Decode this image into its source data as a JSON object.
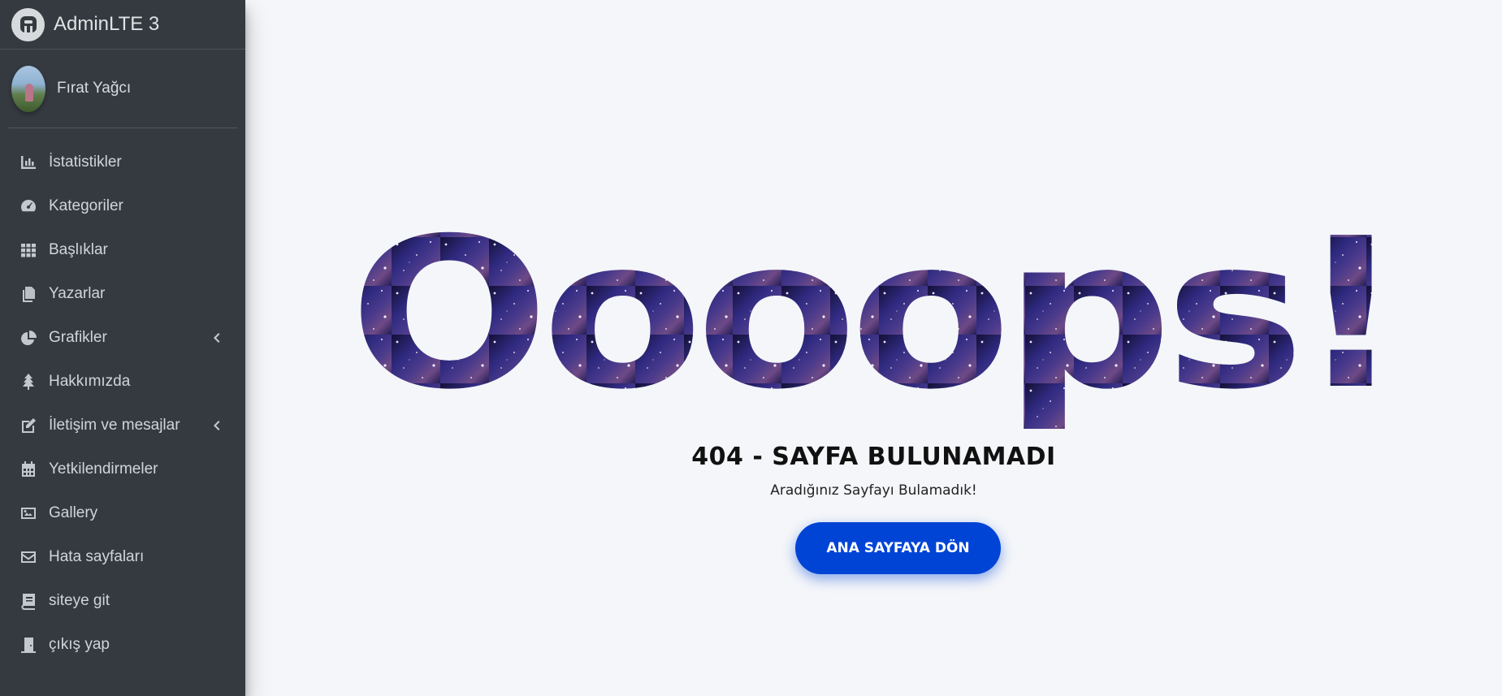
{
  "brand": {
    "title": "AdminLTE 3",
    "logo_icon": "adminlte-logo-icon"
  },
  "user": {
    "name": "Fırat Yağcı"
  },
  "sidebar": {
    "items": [
      {
        "label": "İstatistikler",
        "icon": "bar-chart-icon"
      },
      {
        "label": "Kategoriler",
        "icon": "tachometer-icon"
      },
      {
        "label": "Başlıklar",
        "icon": "grid-icon"
      },
      {
        "label": "Yazarlar",
        "icon": "copy-icon"
      },
      {
        "label": "Grafikler",
        "icon": "pie-chart-icon",
        "has_arrow": true
      },
      {
        "label": "Hakkımızda",
        "icon": "tree-icon"
      },
      {
        "label": "İletişim ve mesajlar",
        "icon": "edit-icon",
        "has_arrow": true
      },
      {
        "label": "Yetkilendirmeler",
        "icon": "calendar-icon"
      },
      {
        "label": "Gallery",
        "icon": "image-icon"
      },
      {
        "label": "Hata sayfaları",
        "icon": "envelope-icon"
      },
      {
        "label": "siteye git",
        "icon": "book-icon"
      },
      {
        "label": "çıkış yap",
        "icon": "door-icon"
      }
    ]
  },
  "error": {
    "headline": "Oooops!",
    "title": "404 - SAYFA BULUNAMADI",
    "subtitle": "Aradığınız Sayfayı Bulamadık!",
    "button_label": "ANA SAYFAYA DÖN"
  },
  "colors": {
    "sidebar_bg": "#343a40",
    "page_bg": "#f4f6f9",
    "button_bg": "#0044d6",
    "headline_fill": "#2d2a6e"
  }
}
